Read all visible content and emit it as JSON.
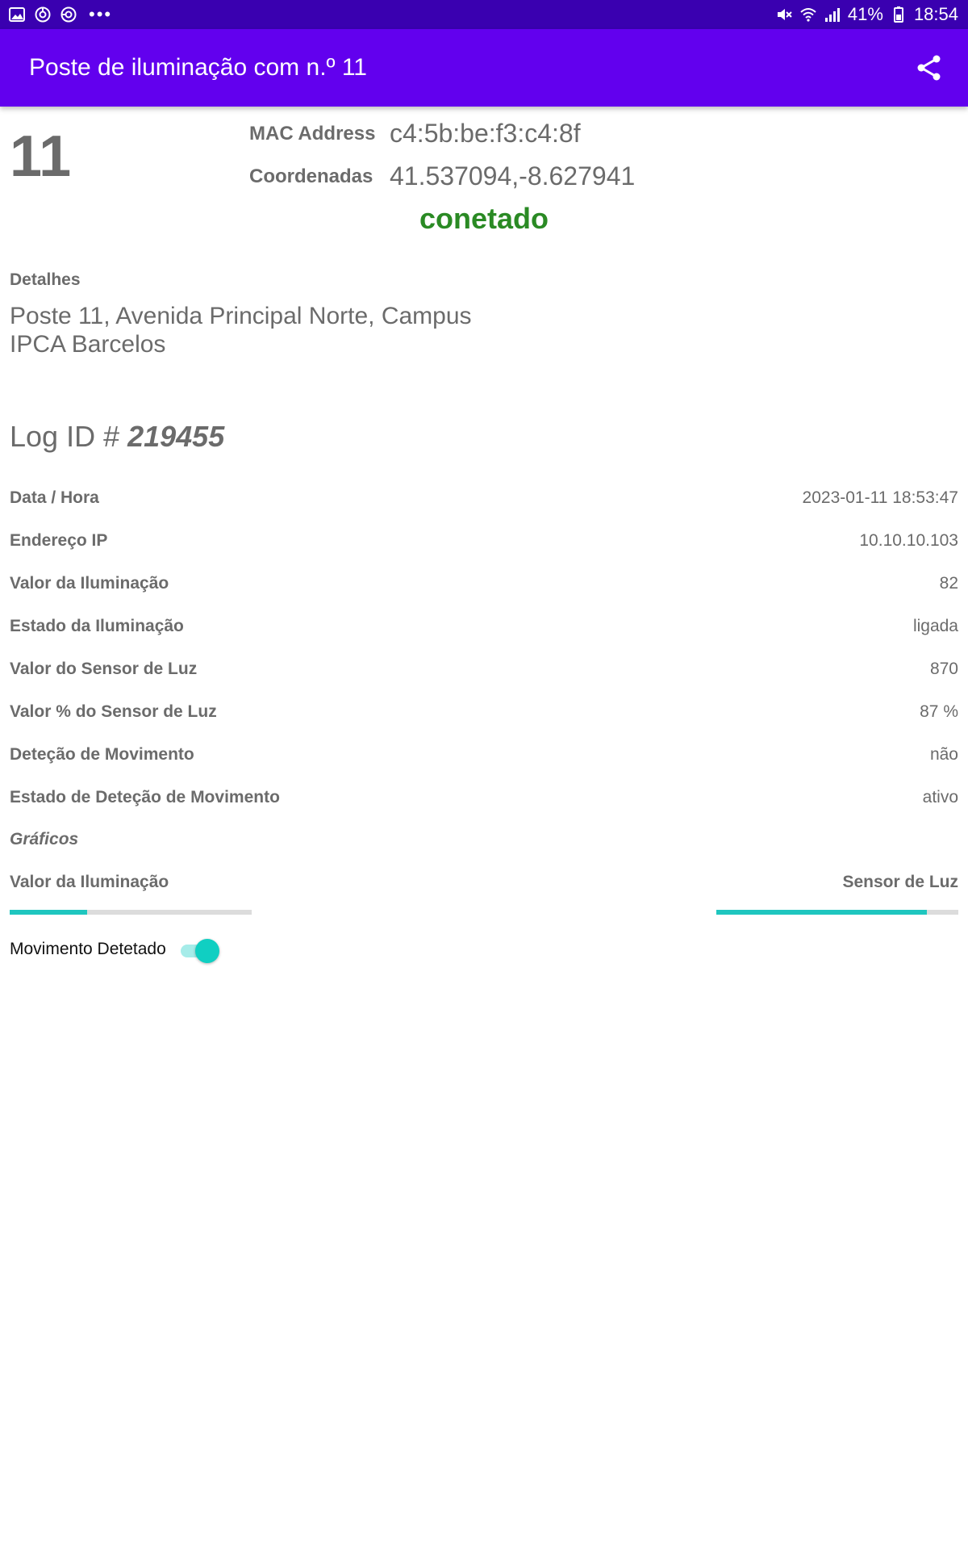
{
  "status_bar": {
    "left_icons": [
      "gallery-icon",
      "sync-icon",
      "sync-alt-icon",
      "more-dots-icon"
    ],
    "right_icons": [
      "mute-icon",
      "wifi-icon",
      "signal-icon",
      "battery-icon"
    ],
    "battery": "41%",
    "time": "18:54",
    "background": "#3a00b0"
  },
  "app_bar": {
    "title": "Poste de iluminação com n.º 11",
    "share_icon": "share-icon",
    "background": "#6200ee"
  },
  "header": {
    "number": "11",
    "mac_label": "MAC Address",
    "mac_value": "c4:5b:be:f3:c4:8f",
    "coord_label": "Coordenadas",
    "coord_value": "41.537094,-8.627941",
    "status": "conetado",
    "status_color": "#2a8a24"
  },
  "details": {
    "label": "Detalhes",
    "text": "Poste 11, Avenida Principal Norte, Campus IPCA Barcelos"
  },
  "log": {
    "prefix": "Log ID # ",
    "id": "219455"
  },
  "rows": [
    {
      "label": "Data / Hora",
      "value": "2023-01-11 18:53:47"
    },
    {
      "label": "Endereço IP",
      "value": "10.10.10.103"
    },
    {
      "label": "Valor da Iluminação",
      "value": "82"
    },
    {
      "label": "Estado da Iluminação",
      "value": "ligada"
    },
    {
      "label": "Valor do Sensor de Luz",
      "value": "870"
    },
    {
      "label": "Valor % do Sensor de Luz",
      "value": "87 %"
    },
    {
      "label": "Deteção de Movimento",
      "value": "não"
    },
    {
      "label": "Estado de Deteção de Movimento",
      "value": "ativo"
    }
  ],
  "charts": {
    "label": "Gráficos",
    "left_label": "Valor da Iluminação",
    "right_label": "Sensor de Luz",
    "left_fraction": 0.32,
    "right_fraction": 0.87,
    "accent": "#1fc6bf"
  },
  "motion": {
    "label": "Movimento Detetado",
    "on": true
  }
}
